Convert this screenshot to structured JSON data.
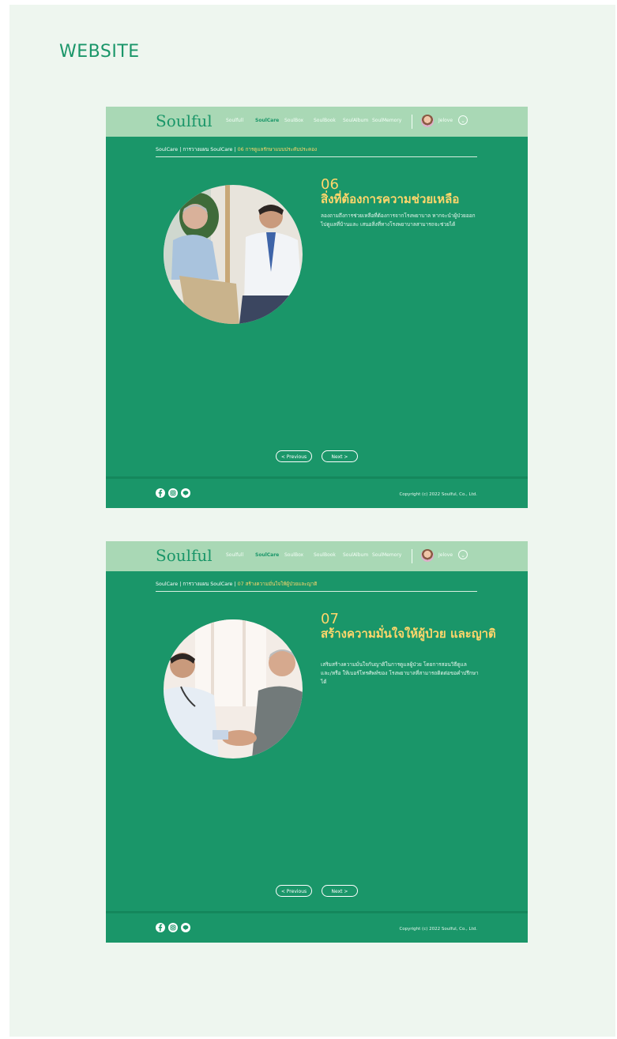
{
  "page": {
    "heading": "WEBSITE"
  },
  "nav": {
    "logo": "Soulful",
    "links": [
      "Soulfull",
      "SoulCare",
      "SoulBox",
      "SoulBook",
      "SoulAlbum",
      "SoulMemory"
    ],
    "active": "SoulCare",
    "user_name": "Jelove",
    "user_menu_icon": "chevron-down-icon"
  },
  "frames": [
    {
      "breadcrumb": {
        "root": "SoulCare",
        "section": "การวางแผน SoulCare",
        "current": "06 การดูแลรักษาแบบประคับประคอง"
      },
      "step_number": "06",
      "step_title": "สิ่งที่ต้องการความช่วยเหลือ",
      "step_desc": "ลองถามถึงการช่วยเหลือที่ต้องการจากโรงพยาบาล หากจะนำผู้ป่วยออกไปดูแลที่บ้านและ เสนอสิ่งที่ทางโรงพยาบาลสามารถจะช่วยได้",
      "photo": "elderly-patient-with-doctor",
      "prev_label": "< Previous",
      "next_label": "Next >"
    },
    {
      "breadcrumb": {
        "root": "SoulCare",
        "section": "การวางแผน SoulCare",
        "current": "07 สร้างความมั่นใจให้ผู้ป่วยและญาติ"
      },
      "step_number": "07",
      "step_title": "สร้างความมั่นใจให้ผู้ป่วย และญาติ",
      "step_desc": "เสริมสร้างความมั่นใจกับญาติในการดูแลผู้ป่วย โดยการสอนวิธีดูแล และ/หรือ ให้เบอร์โทรศัพท์ของ โรงพยาบาลที่สามารถติดต่อขอคำปรึกษาได้",
      "photo": "doctor-shaking-hands-with-patient",
      "prev_label": "< Previous",
      "next_label": "Next >"
    }
  ],
  "footer": {
    "social": [
      "facebook-icon",
      "instagram-icon",
      "line-icon"
    ],
    "copyright": "Copyright (c) 2022 Soulful, Co., Ltd."
  },
  "colors": {
    "brand_green": "#1a9669",
    "nav_green": "#a9d8b5",
    "accent_yellow": "#ffd66b",
    "background": "#eef6ef"
  }
}
